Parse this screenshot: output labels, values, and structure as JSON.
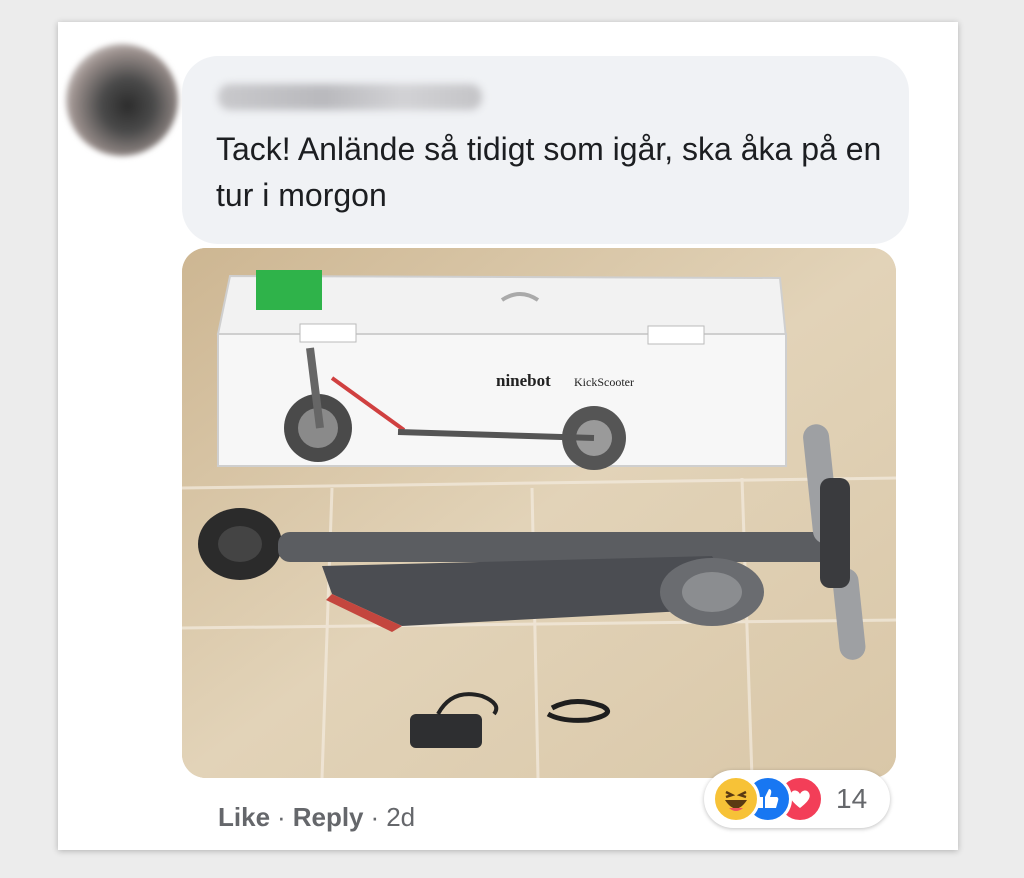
{
  "comment": {
    "author_name": "",
    "text": "Tack! Anlände så tidigt som igår, ska åka på en tur i morgon"
  },
  "photo": {
    "box_brand": "ninebot",
    "box_product": "KickScooter"
  },
  "actions": {
    "like_label": "Like",
    "separator": "·",
    "reply_label": "Reply",
    "time": "2d"
  },
  "reactions": {
    "icons": [
      "haha-reaction-icon",
      "like-reaction-icon",
      "love-reaction-icon"
    ],
    "count": "14"
  },
  "colors": {
    "bubble_bg": "#f0f2f5",
    "text": "#1c1e21",
    "meta": "#65676b",
    "like_blue": "#1877f2",
    "love_red": "#f33e58",
    "haha_yellow": "#f7c237"
  }
}
